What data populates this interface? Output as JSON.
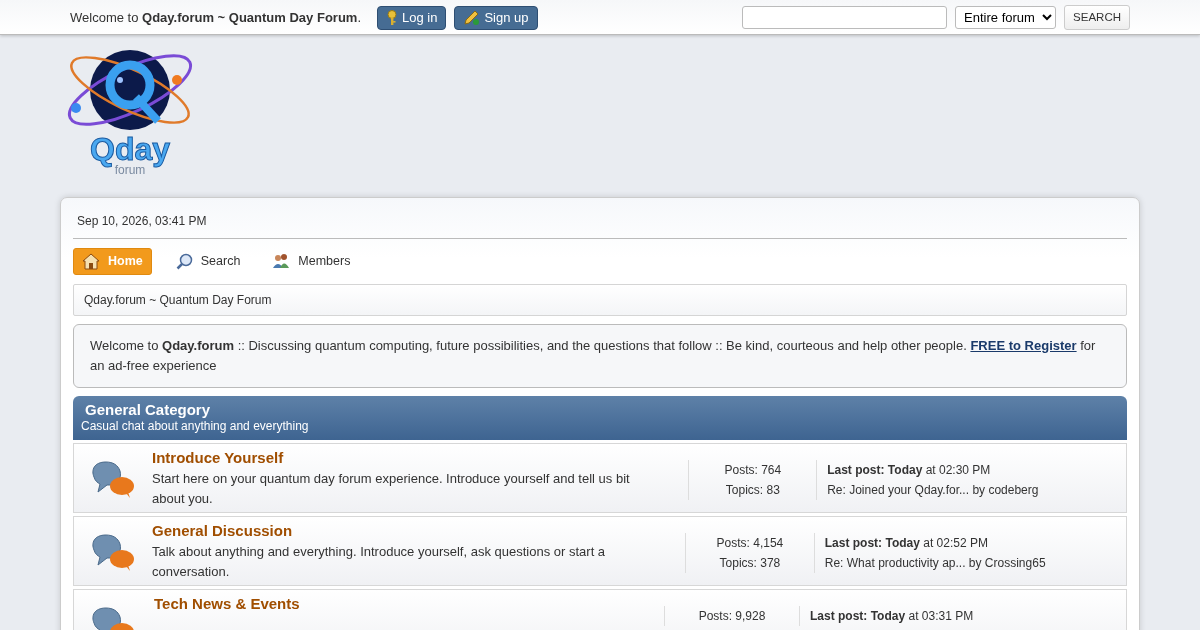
{
  "top_bar": {
    "welcome": "Welcome to **Qday.forum ~ Quantum Day Forum**.",
    "buttons": [
      {
        "kind": "login",
        "label": "Log in"
      },
      {
        "kind": "signup",
        "label": "Sign up"
      }
    ],
    "search": {
      "scope": "Entire forum",
      "button": "SEARCH"
    }
  },
  "logo": {
    "title": "Qday",
    "subtitle": "forum"
  },
  "date": "Sep 10, 2026, 03:41 PM",
  "menu": [
    {
      "kind": "home",
      "label": "Home",
      "selected": true
    },
    {
      "kind": "search",
      "label": "Search",
      "selected": false
    },
    {
      "kind": "members",
      "label": "Members",
      "selected": false
    }
  ],
  "breadcrumb": "Qday.forum ~ Quantum Day Forum",
  "notice": {
    "text": "Welcome to **Qday.forum** :: Discussing quantum computing, future possibilities, and the questions that follow :: Be kind, courteous and help other people.",
    "link": "FREE to Register",
    "after": "for an ad-free experience"
  },
  "category": {
    "title": "General Category",
    "description": "Casual chat about anything and everything",
    "boards": [
      {
        "name": "Introduce Yourself",
        "description": "Start here on your quantum day forum experience. Introduce yourself and tell us bit about you.",
        "posts": "Posts: 764",
        "topics": "Topics: 83",
        "last_post": "**Last post: Today** at 02:30 PM",
        "last_topic": "Re: Joined your Qday.for...",
        "by": "by codeberg"
      },
      {
        "name": "General Discussion",
        "description": "Talk about anything and everything. Introduce yourself, ask questions or start a conversation.",
        "posts": "Posts: 4,154",
        "topics": "Topics: 378",
        "last_post": "**Last post: Today** at 02:52 PM",
        "last_topic": "Re: What productivity ap...",
        "by": "by Crossing65"
      },
      {
        "name": "Tech News & Events",
        "posts": "Posts: 9,928",
        "last_post": "**Last post: Today** at 03:31 PM"
      }
    ]
  }
}
